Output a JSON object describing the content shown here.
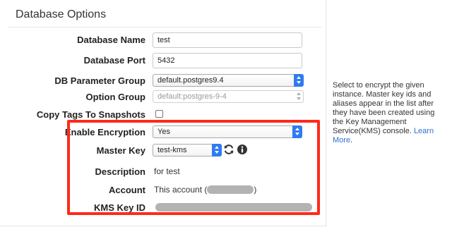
{
  "section": {
    "title": "Database Options"
  },
  "fields": {
    "db_name": {
      "label": "Database Name",
      "value": "test"
    },
    "db_port": {
      "label": "Database Port",
      "value": "5432"
    },
    "param_group": {
      "label": "DB Parameter Group",
      "value": "default.postgres9.4"
    },
    "option_group": {
      "label": "Option Group",
      "value": "default:postgres-9-4"
    },
    "copy_tags": {
      "label": "Copy Tags To Snapshots",
      "checked": false
    },
    "encryption": {
      "label": "Enable Encryption",
      "value": "Yes"
    },
    "master_key": {
      "label": "Master Key",
      "value": "test-kms"
    },
    "description": {
      "label": "Description",
      "value": "for test"
    },
    "account": {
      "label": "Account",
      "prefix": "This account (",
      "suffix": ")"
    },
    "kms_key_id": {
      "label": "KMS Key ID"
    }
  },
  "help": {
    "text": "Select to encrypt the given instance. Master key ids and aliases appear in the list after they have been created using the Key Management Service(KMS) console. ",
    "link": "Learn More",
    "trailing": "."
  },
  "icons": {
    "refresh": "refresh-icon",
    "info": "info-icon"
  },
  "colors": {
    "highlight": "#ff2a18",
    "accent": "#2f7bf1",
    "link": "#2f6fd0"
  }
}
